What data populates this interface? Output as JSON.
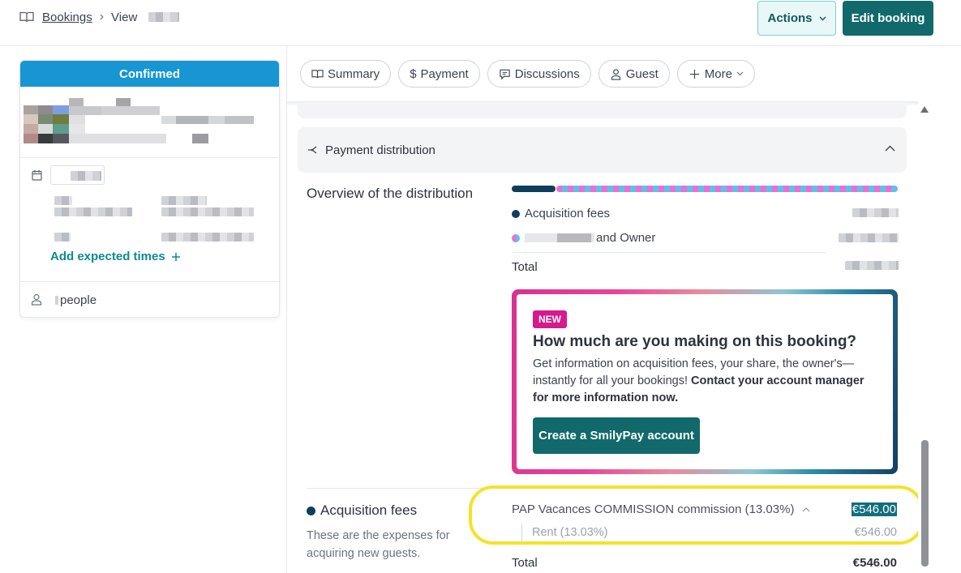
{
  "header": {
    "breadcrumb_root": "Bookings",
    "breadcrumb_current": "View",
    "actions_label": "Actions",
    "edit_label": "Edit booking"
  },
  "sidebar": {
    "status": "Confirmed",
    "add_expected_times": "Add expected times",
    "people_label": "people",
    "status_color": "#1796d3"
  },
  "tabs": [
    {
      "label": "Summary",
      "icon": "book-icon"
    },
    {
      "label": "Payment",
      "icon": "dollar-icon"
    },
    {
      "label": "Discussions",
      "icon": "chat-icon"
    },
    {
      "label": "Guest",
      "icon": "person-icon"
    },
    {
      "label": "More",
      "icon": "plus-icon"
    }
  ],
  "distribution": {
    "section_title": "Payment distribution",
    "overview_label": "Overview of the distribution",
    "legend": [
      {
        "label": "Acquisition fees"
      },
      {
        "label": "and Owner"
      }
    ],
    "total_label": "Total"
  },
  "promo": {
    "badge": "NEW",
    "title": "How much are you making on this booking?",
    "text_plain": "Get information on acquisition fees, your share, the owner's— instantly for all your bookings! ",
    "text_bold": "Contact your account manager for more information now.",
    "button": "Create a SmilyPay account"
  },
  "acquisition": {
    "title": "Acquisition fees",
    "description": "These are the expenses for acquiring new guests.",
    "commission_label": "PAP Vacances COMMISSION commission (13.03%)",
    "commission_value": "€546.00",
    "rent_label": "Rent (13.03%)",
    "rent_value": "€546.00",
    "total_label": "Total",
    "total_value": "€546.00"
  },
  "colors": {
    "brand_teal": "#11696b",
    "accent_link": "#0f8a8f",
    "highlight": "#f4e22a"
  }
}
